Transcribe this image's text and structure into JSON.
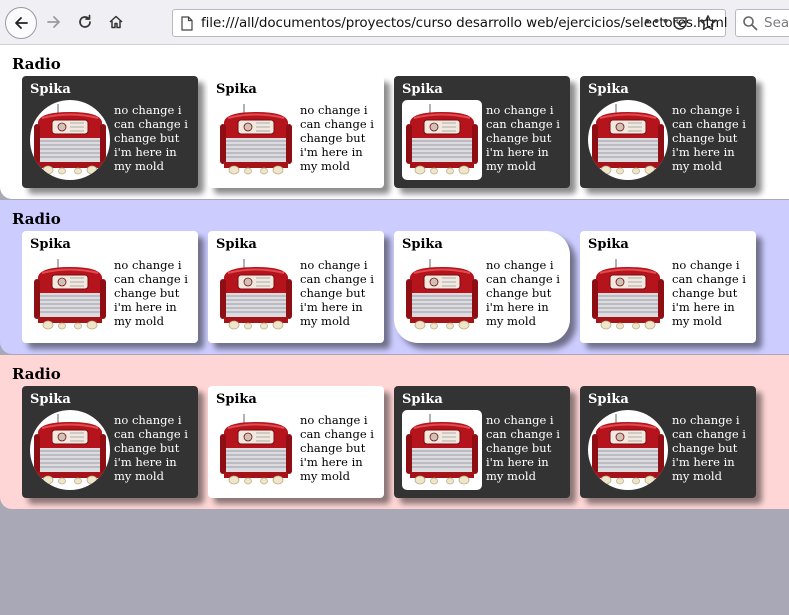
{
  "browser": {
    "url": "file:///all/documentos/proyectos/curso desarrollo web/ejercicios/selectores.html",
    "search_placeholder": "Search",
    "more_label": "•••",
    "icons": [
      "back-arrow-icon",
      "forward-arrow-icon",
      "reload-icon",
      "home-icon",
      "page-icon",
      "more-icon",
      "pocket-icon",
      "bookmark-star-icon",
      "search-icon"
    ]
  },
  "sections": [
    {
      "title": "Radio",
      "background": "#ffffff",
      "cards": [
        {
          "name": "Spika",
          "text": "no change i can change i change but i'm here in my mold",
          "theme": "dark",
          "image_shape": "circle"
        },
        {
          "name": "Spika",
          "text": "no change i can change i change but i'm here in my mold",
          "theme": "light",
          "image_shape": "plain"
        },
        {
          "name": "Spika",
          "text": "no change i can change i change but i'm here in my mold",
          "theme": "dark",
          "image_shape": "rounded"
        },
        {
          "name": "Spika",
          "text": "no change i can change i change but i'm here in my mold",
          "theme": "dark",
          "image_shape": "circle"
        }
      ]
    },
    {
      "title": "Radio",
      "background": "#ccccff",
      "cards": [
        {
          "name": "Spika",
          "text": "no change i can change i change but i'm here in my mold",
          "theme": "light",
          "image_shape": "plain"
        },
        {
          "name": "Spika",
          "text": "no change i can change i change but i'm here in my mold",
          "theme": "light",
          "image_shape": "plain"
        },
        {
          "name": "Spika",
          "text": "no change i can change i change but i'm here in my mold",
          "theme": "light",
          "image_shape": "plain"
        },
        {
          "name": "Spika",
          "text": "no change i can change i change but i'm here in my mold",
          "theme": "light",
          "image_shape": "plain"
        }
      ]
    },
    {
      "title": "Radio",
      "background": "#ffd6d6",
      "cards": [
        {
          "name": "Spika",
          "text": "no change i can change i change but i'm here in my mold",
          "theme": "dark",
          "image_shape": "circle"
        },
        {
          "name": "Spika",
          "text": "no change i can change i change but i'm here in my mold",
          "theme": "light",
          "image_shape": "plain"
        },
        {
          "name": "Spika",
          "text": "no change i can change i change but i'm here in my mold",
          "theme": "dark",
          "image_shape": "rounded"
        },
        {
          "name": "Spika",
          "text": "no change i can change i change but i'm here in my mold",
          "theme": "dark",
          "image_shape": "circle"
        }
      ]
    }
  ],
  "colors": {
    "page_bg": "#a8a8b6",
    "card_dark": "#333333",
    "card_light": "#ffffff",
    "radio_red": "#b5141c"
  }
}
